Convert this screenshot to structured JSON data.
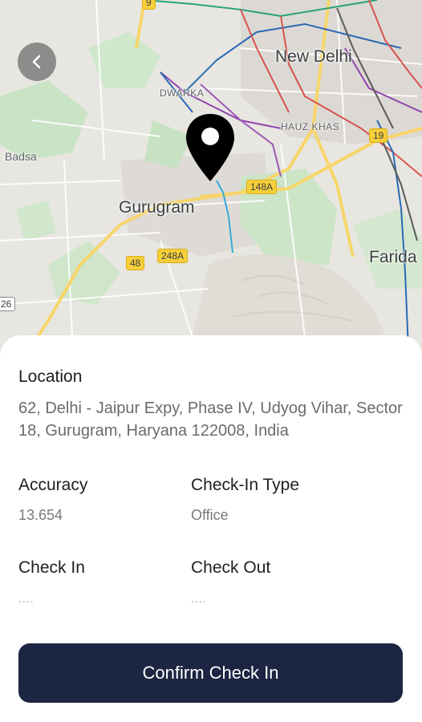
{
  "map": {
    "labels": {
      "new_delhi": "New Delhi",
      "dwarka": "DWARKA",
      "hauz_khas": "HAUZ KHAS",
      "badsa": "Badsa",
      "gurugram": "Gurugram",
      "faridabad": "Farida"
    },
    "shields": {
      "top": "9",
      "nh19": "19",
      "nh148a": "148A",
      "nh48": "48",
      "nh248a": "248A",
      "left": "26"
    },
    "pin_icon": "map-pin-icon",
    "back_icon": "arrow-left-icon"
  },
  "details": {
    "location_label": "Location",
    "location_value": "62, Delhi - Jaipur Expy, Phase IV, Udyog Vihar, Sector 18, Gurugram, Haryana 122008, India",
    "accuracy_label": "Accuracy",
    "accuracy_value": "13.654",
    "checkin_type_label": "Check-In Type",
    "checkin_type_value": "Office",
    "checkin_label": "Check In",
    "checkin_value": "....",
    "checkout_label": "Check Out",
    "checkout_value": "...."
  },
  "actions": {
    "confirm_label": "Confirm Check In"
  },
  "colors": {
    "button_bg": "#1c2541",
    "pin": "#000000",
    "shield": "#f6cf3a"
  }
}
